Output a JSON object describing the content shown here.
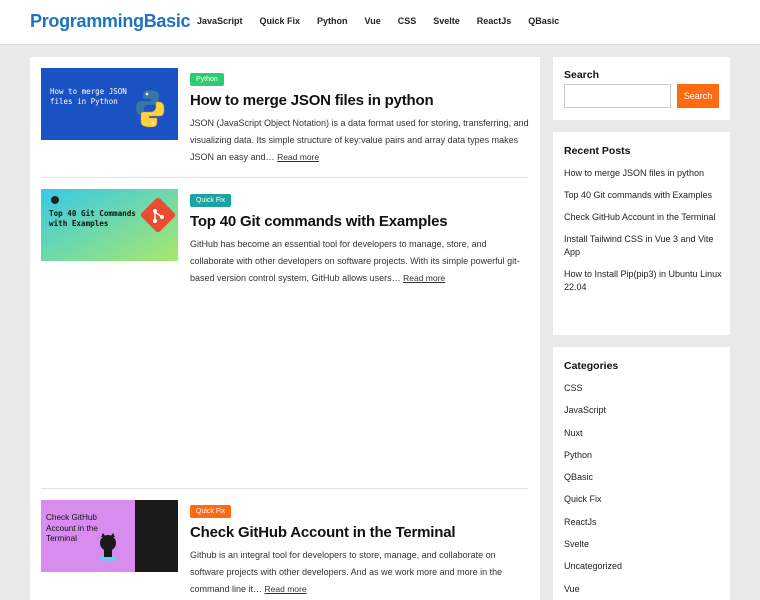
{
  "site": {
    "logo": "ProgrammingBasic"
  },
  "nav": [
    "JavaScript",
    "Quick Fix",
    "Python",
    "Vue",
    "CSS",
    "Svelte",
    "ReactJs",
    "QBasic"
  ],
  "colors": {
    "accent": "#1e73be",
    "search_button": "#ff6a13",
    "python_badge": "#2ecc71",
    "quickfix_badge_1": "#1aa3a3",
    "quickfix_badge_2": "#ff6a13"
  },
  "posts": [
    {
      "category": "Python",
      "title": "How to merge JSON files in python",
      "excerpt": "JSON (JavaScript Object Notation) is a data format used for storing, transferring, and visualizing data. Its simple structure of key:value pairs and array data types makes JSON an easy and…",
      "read_more": "Read more",
      "thumb_text": "How to merge JSON files in Python"
    },
    {
      "category": "Quick Fix",
      "title": "Top 40 Git commands with Examples",
      "excerpt": "GitHub has become an essential tool for developers to manage, store, and collaborate with other developers on software projects. With its simple powerful git-based version control system, GitHub allows users…",
      "read_more": "Read more",
      "thumb_text": "Top 40 Git Commands with Examples"
    },
    {
      "category": "Quick Fix",
      "title": "Check GitHub Account in the Terminal",
      "excerpt": "Github is an integral tool for developers to store, manage, and collaborate on software projects with other developers. And as we work more and more in the command line it…",
      "read_more": "Read more",
      "thumb_text": "Check GitHub Account in the Terminal"
    }
  ],
  "sidebar": {
    "search": {
      "title": "Search",
      "button": "Search"
    },
    "recent": {
      "title": "Recent Posts",
      "items": [
        "How to merge JSON files in python",
        "Top 40 Git commands with Examples",
        "Check GitHub Account in the Terminal",
        "Install Tailwind CSS in Vue 3 and Vite App",
        "How to Install Pip(pip3) in Ubuntu Linux 22.04"
      ]
    },
    "categories": {
      "title": "Categories",
      "items": [
        "CSS",
        "JavaScript",
        "Nuxt",
        "Python",
        "QBasic",
        "Quick Fix",
        "ReactJs",
        "Svelte",
        "Uncategorized",
        "Vue"
      ]
    }
  }
}
